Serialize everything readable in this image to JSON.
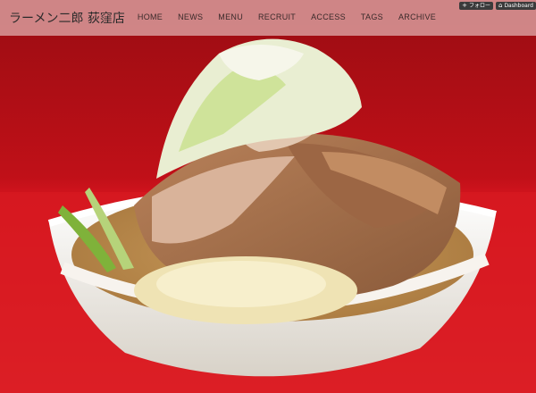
{
  "header": {
    "site_title": "ラーメン二郎 荻窪店",
    "nav": [
      "HOME",
      "NEWS",
      "MENU",
      "RECRUIT",
      "ACCESS",
      "TAGS",
      "ARCHIVE"
    ]
  },
  "controls": {
    "follow_label": "フォロー",
    "follow_icon": "plus-icon",
    "dashboard_label": "Dashboard",
    "dashboard_icon": "home-icon"
  },
  "colors": {
    "header_bg": "#d69696",
    "background_red": "#c8141c",
    "bowl": "#f3efe8"
  }
}
